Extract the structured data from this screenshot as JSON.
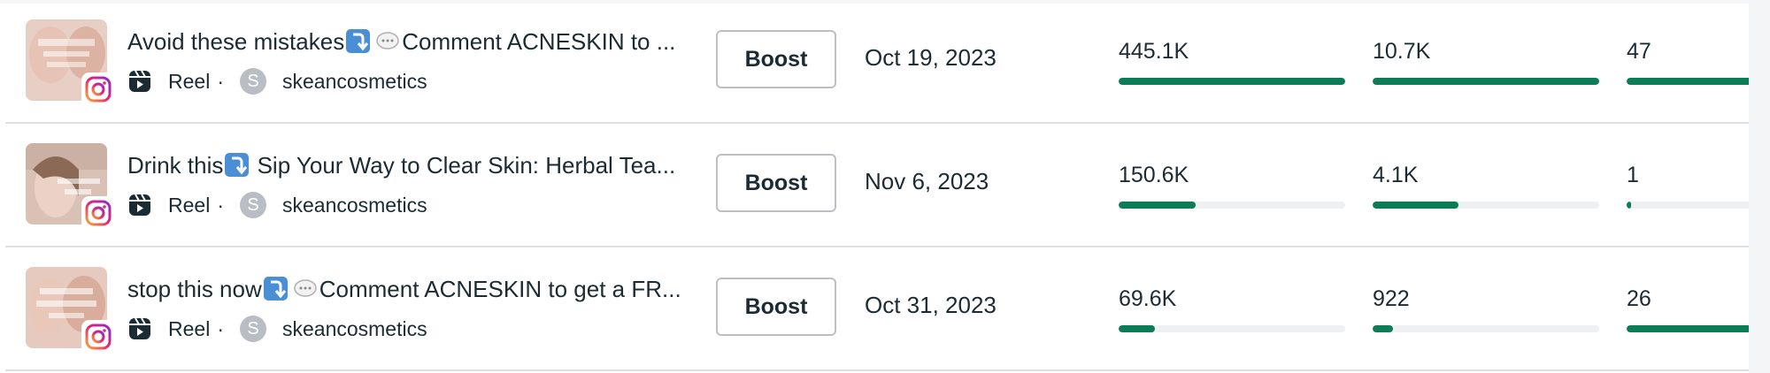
{
  "colors": {
    "accent": "#0a7c56",
    "track": "#eef0f2",
    "divider": "#dcdfe3"
  },
  "rows": [
    {
      "title_prefix": "Avoid these mistakes",
      "title_suffix": "Comment ACNESKIN to ...",
      "type": "Reel",
      "separator": "·",
      "account_initial": "S",
      "account": "skeancosmetics",
      "boost_label": "Boost",
      "date": "Oct 19, 2023",
      "metric1": {
        "value": "445.1K",
        "fill": 1.0
      },
      "metric2": {
        "value": "10.7K",
        "fill": 1.0
      },
      "metric3": {
        "value": "47",
        "fill": 1.0
      }
    },
    {
      "title_prefix": "Drink this",
      "title_suffix": "Sip Your Way to Clear Skin: Herbal Tea...",
      "type": "Reel",
      "separator": "·",
      "account_initial": "S",
      "account": "skeancosmetics",
      "boost_label": "Boost",
      "date": "Nov 6, 2023",
      "metric1": {
        "value": "150.6K",
        "fill": 0.34
      },
      "metric2": {
        "value": "4.1K",
        "fill": 0.38
      },
      "metric3": {
        "value": "1",
        "fill": 0.02
      }
    },
    {
      "title_prefix": "stop this now",
      "title_suffix": "Comment ACNESKIN to get a FR...",
      "type": "Reel",
      "separator": "·",
      "account_initial": "S",
      "account": "skeancosmetics",
      "boost_label": "Boost",
      "date": "Oct 31, 2023",
      "metric1": {
        "value": "69.6K",
        "fill": 0.16
      },
      "metric2": {
        "value": "922",
        "fill": 0.09
      },
      "metric3": {
        "value": "26",
        "fill": 0.55
      }
    }
  ]
}
